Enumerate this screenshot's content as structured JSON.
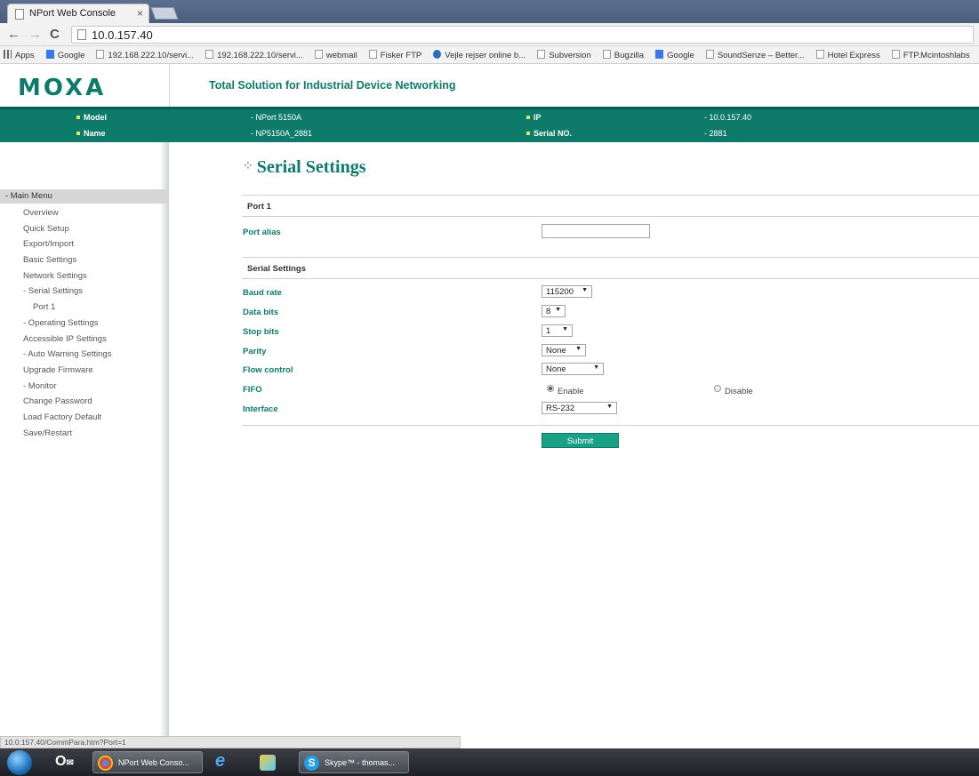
{
  "browser": {
    "tab_title": "NPort Web Console",
    "tab_close": "×",
    "url": "10.0.157.40",
    "bookmarks": [
      "Apps",
      "Google",
      "192.168.222.10/servi...",
      "192.168.222.10/servi...",
      "webmail",
      "Fisker FTP",
      "Vejle rejser online b...",
      "Subversion",
      "Bugzilla",
      "Google",
      "SoundSenze – Better...",
      "Hotel Express",
      "FTP.Mcintoshlabs"
    ]
  },
  "header": {
    "logo": "MOXA",
    "tagline": "Total Solution for Industrial Device Networking"
  },
  "info": {
    "model_label": "Model",
    "model_value": "- NPort 5150A",
    "name_label": "Name",
    "name_value": "- NP5150A_2881",
    "ip_label": "IP",
    "ip_value": "- 10.0.157.40",
    "serial_label": "Serial NO.",
    "serial_value": "- 2881"
  },
  "sidebar": {
    "head": "- Main Menu",
    "items": [
      "Overview",
      "Quick Setup",
      "Export/Import",
      "Basic Settings",
      "Network Settings",
      "- Serial Settings",
      "Port 1",
      "- Operating Settings",
      "Accessible IP Settings",
      "- Auto Warning Settings",
      "Upgrade Firmware",
      "- Monitor",
      "Change Password",
      "Load Factory Default",
      "Save/Restart"
    ]
  },
  "main": {
    "title": "Serial Settings",
    "section_port": "Port 1",
    "port_alias_label": "Port alias",
    "port_alias_value": "",
    "section_serial": "Serial Settings",
    "baud_label": "Baud rate",
    "baud_value": "115200",
    "data_bits_label": "Data bits",
    "data_bits_value": "8",
    "stop_bits_label": "Stop bits",
    "stop_bits_value": "1",
    "parity_label": "Parity",
    "parity_value": "None",
    "flow_label": "Flow control",
    "flow_value": "None",
    "fifo_label": "FIFO",
    "fifo_enable": "Enable",
    "fifo_disable": "Disable",
    "interface_label": "Interface",
    "interface_value": "RS-232",
    "submit": "Submit"
  },
  "status": {
    "url": "10.0.157.40/CommPara.htm?Port=1"
  },
  "taskbar": {
    "nport_label": "NPort Web Conso...",
    "skype_label": "Skype™ - thomas...",
    "outlook_label": "O"
  },
  "colors": {
    "brand": "#0e7a69",
    "submit": "#19a085"
  }
}
